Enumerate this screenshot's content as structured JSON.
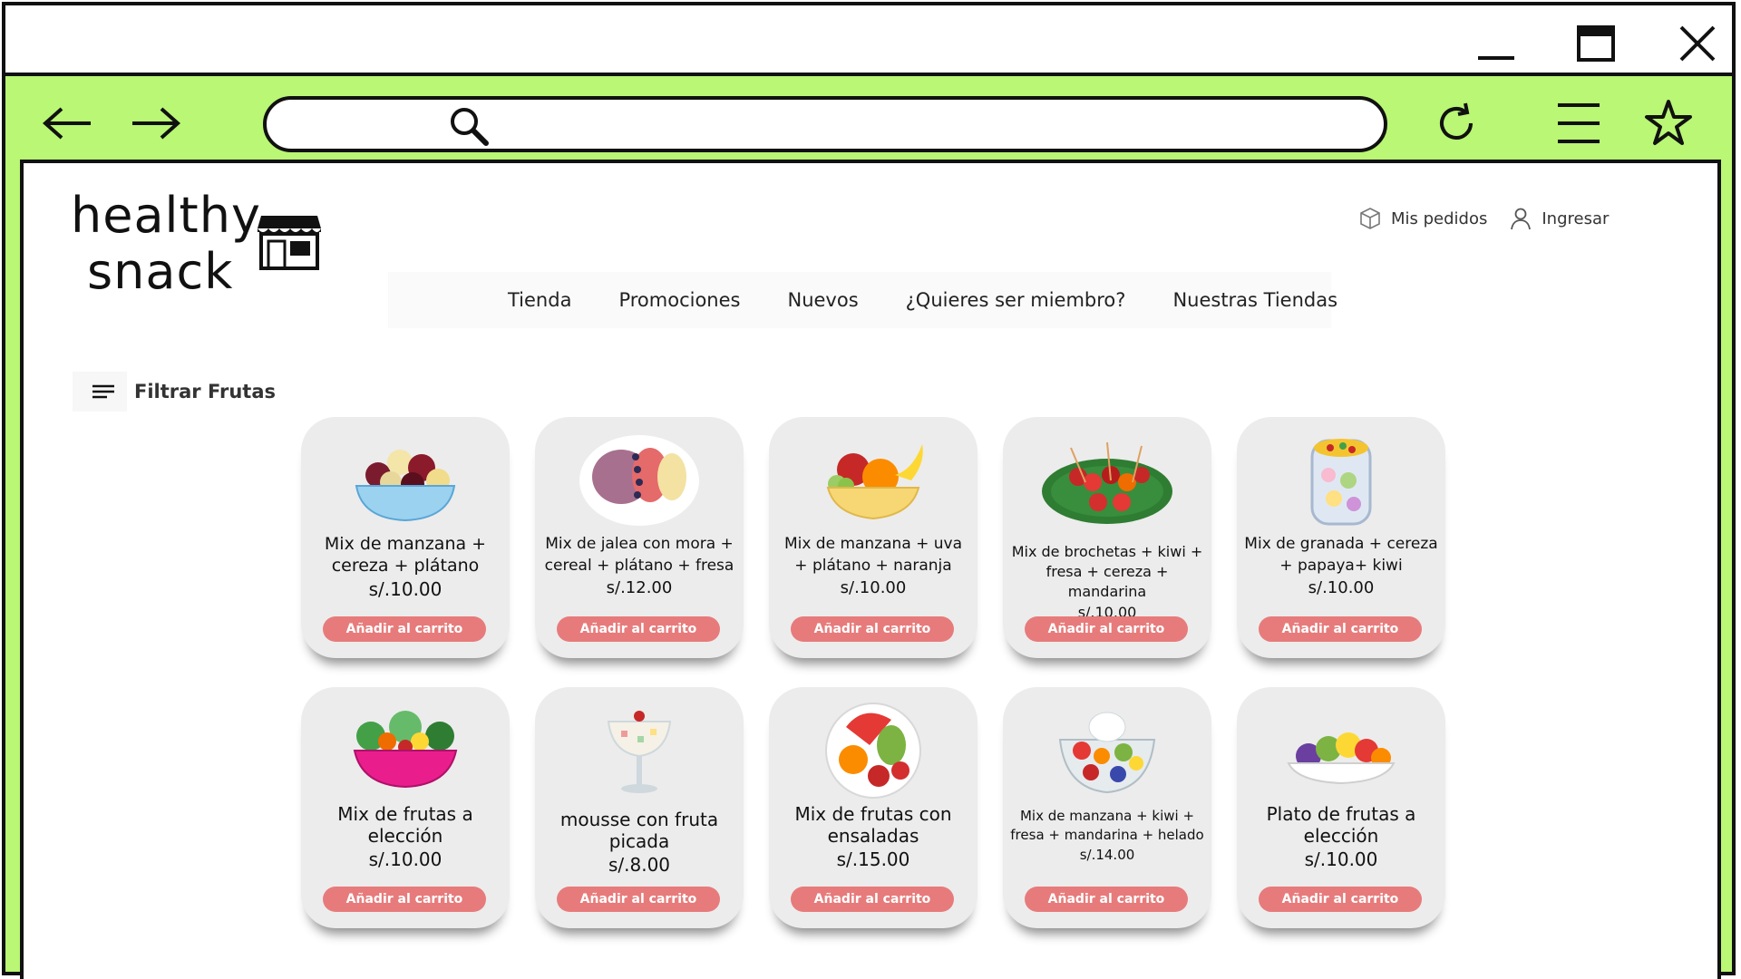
{
  "brand": {
    "line1": "healthy",
    "line2": "snack"
  },
  "account": {
    "orders_label": "Mis pedidos",
    "login_label": "Ingresar"
  },
  "nav": {
    "tabs": [
      "Tienda",
      "Promociones",
      "Nuevos",
      "¿Quieres ser miembro?",
      "Nuestras Tiendas"
    ]
  },
  "filter": {
    "label": "Filtrar Frutas"
  },
  "products": [
    {
      "name": "Mix de manzana + cereza + plátano",
      "price": "s/.10.00",
      "button": "Añadir al carrito",
      "icon": "fruit-bowl-blue-icon"
    },
    {
      "name": "Mix de jalea con mora + cereal + plátano + fresa",
      "price": "s/.12.00",
      "button": "Añadir al carrito",
      "icon": "acai-bowl-icon"
    },
    {
      "name": "Mix de manzana + uva + plátano + naranja",
      "price": "s/.10.00",
      "button": "Añadir al carrito",
      "icon": "fruit-basket-icon"
    },
    {
      "name": "Mix de brochetas + kiwi + fresa + cereza + mandarina",
      "price": "s/.10.00",
      "button": "Añadir al carrito",
      "icon": "fruit-skewers-icon"
    },
    {
      "name": "Mix de granada + cereza + papaya+ kiwi",
      "price": "s/.10.00",
      "button": "Añadir al carrito",
      "icon": "fruit-cup-icon"
    },
    {
      "name": "Mix de frutas a elección",
      "price": "s/.10.00",
      "button": "Añadir al carrito",
      "icon": "salad-bowl-pink-icon"
    },
    {
      "name": "mousse con fruta picada",
      "price": "s/.8.00",
      "button": "Añadir al carrito",
      "icon": "mousse-glass-icon"
    },
    {
      "name": "Mix de frutas con ensaladas",
      "price": "s/.15.00",
      "button": "Añadir al carrito",
      "icon": "fruit-plate-icon"
    },
    {
      "name": "Mix de manzana + kiwi + fresa + mandarina + helado",
      "price": "s/.14.00",
      "button": "Añadir al carrito",
      "icon": "fruit-icecream-bowl-icon"
    },
    {
      "name": "Plato de frutas a elección",
      "price": "s/.10.00",
      "button": "Añadir al carrito",
      "icon": "fruit-dish-icon"
    }
  ],
  "colors": {
    "browser_chrome": "#b9f774",
    "button": "#e77b7b",
    "card": "#ececec"
  }
}
